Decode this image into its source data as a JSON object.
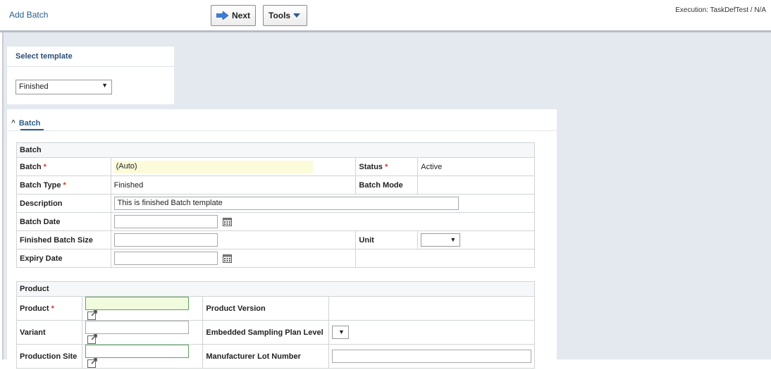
{
  "header": {
    "title": "Add Batch",
    "next_label": "Next",
    "tools_label": "Tools",
    "execution": "Execution: TaskDefTest / N/A"
  },
  "template": {
    "heading": "Select template",
    "selected": "Finished"
  },
  "section": {
    "tab_label": "Batch"
  },
  "batch": {
    "heading": "Batch",
    "batch_label": "Batch",
    "batch_value": "(Auto)",
    "status_label": "Status",
    "status_value": "Active",
    "batch_type_label": "Batch Type",
    "batch_type_value": "Finished",
    "batch_mode_label": "Batch Mode",
    "description_label": "Description",
    "description_value": "This is finished Batch template",
    "batch_date_label": "Batch Date",
    "finished_size_label": "Finished Batch Size",
    "unit_label": "Unit",
    "expiry_date_label": "Expiry Date"
  },
  "product": {
    "heading": "Product",
    "product_label": "Product",
    "product_version_label": "Product Version",
    "variant_label": "Variant",
    "sampling_label": "Embedded Sampling Plan Level",
    "production_site_label": "Production Site",
    "manufacturer_lot_label": "Manufacturer Lot Number"
  },
  "colors": {
    "accent": "#2a5d8a",
    "required": "#d9342b",
    "workspace_bg": "#e4e9f0",
    "auto_field_bg": "#fbfbd9"
  },
  "icons": {
    "next": "arrow-right-icon",
    "tools": "caret-down-icon",
    "date": "calendar-icon",
    "lookup": "external-link-icon"
  }
}
